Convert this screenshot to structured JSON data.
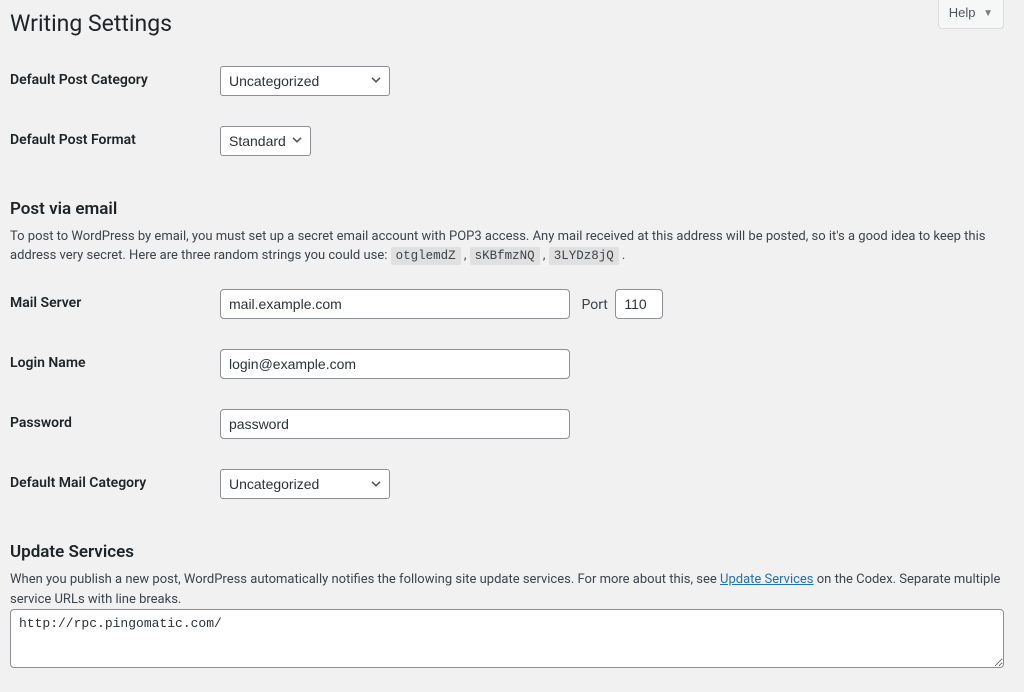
{
  "help_label": "Help",
  "page_title": "Writing Settings",
  "rows": {
    "default_category": {
      "label": "Default Post Category",
      "options": [
        "Uncategorized"
      ]
    },
    "default_format": {
      "label": "Default Post Format",
      "options": [
        "Standard"
      ]
    }
  },
  "post_via_email": {
    "heading": "Post via email",
    "desc_before": "To post to WordPress by email, you must set up a secret email account with POP3 access. Any mail received at this address will be posted, so it's a good idea to keep this address very secret. Here are three random strings you could use: ",
    "codes": [
      "otglemdZ",
      "sKBfmzNQ",
      "3LYDz8jQ"
    ],
    "sep": " , ",
    "end": " .",
    "mail_server": {
      "label": "Mail Server",
      "value": "mail.example.com",
      "port_label": "Port",
      "port_value": "110"
    },
    "login_name": {
      "label": "Login Name",
      "value": "login@example.com"
    },
    "password": {
      "label": "Password",
      "value": "password"
    },
    "default_mail_category": {
      "label": "Default Mail Category",
      "options": [
        "Uncategorized"
      ]
    }
  },
  "update_services": {
    "heading": "Update Services",
    "desc_before": "When you publish a new post, WordPress automatically notifies the following site update services. For more about this, see ",
    "link_text": "Update Services",
    "desc_after": " on the Codex. Separate multiple service URLs with line breaks.",
    "textarea_value": "http://rpc.pingomatic.com/"
  }
}
